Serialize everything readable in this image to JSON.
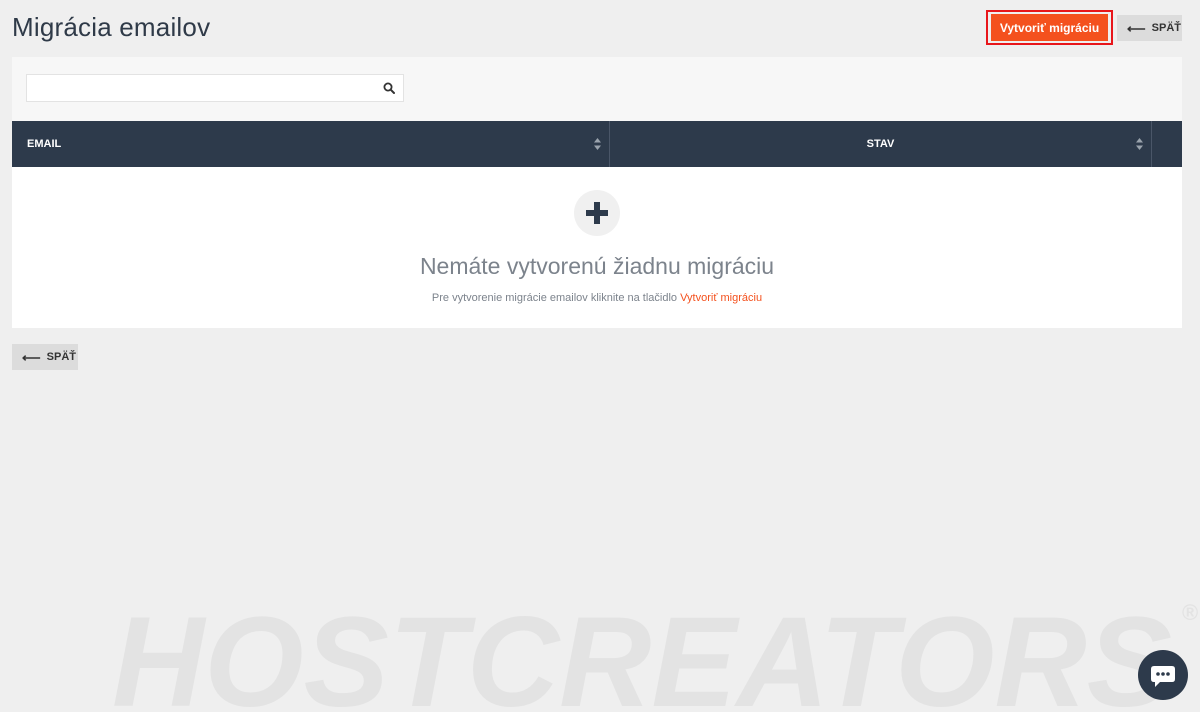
{
  "header": {
    "title": "Migrácia emailov",
    "create_button_label": "Vytvoriť migráciu",
    "back_label": "SPÄŤ"
  },
  "search": {
    "value": "",
    "placeholder": ""
  },
  "table": {
    "columns": [
      "EMAIL",
      "STAV"
    ],
    "rows": []
  },
  "empty_state": {
    "title": "Nemáte vytvorenú žiadnu migráciu",
    "description": "Pre vytvorenie migrácie emailov kliknite na tlačidlo",
    "link_label": "Vytvoriť migráciu"
  },
  "footer": {
    "back_label": "SPÄŤ"
  },
  "watermark": {
    "text": "HOSTCREATORS",
    "registered_mark": "®"
  },
  "colors": {
    "accent": "#f4511e",
    "highlight_border": "#e8161b",
    "table_header": "#2d3a4b",
    "background": "#efefef"
  },
  "icons": [
    "search-icon",
    "sort-icon",
    "plus-icon",
    "arrow-left-icon",
    "chat-icon"
  ]
}
